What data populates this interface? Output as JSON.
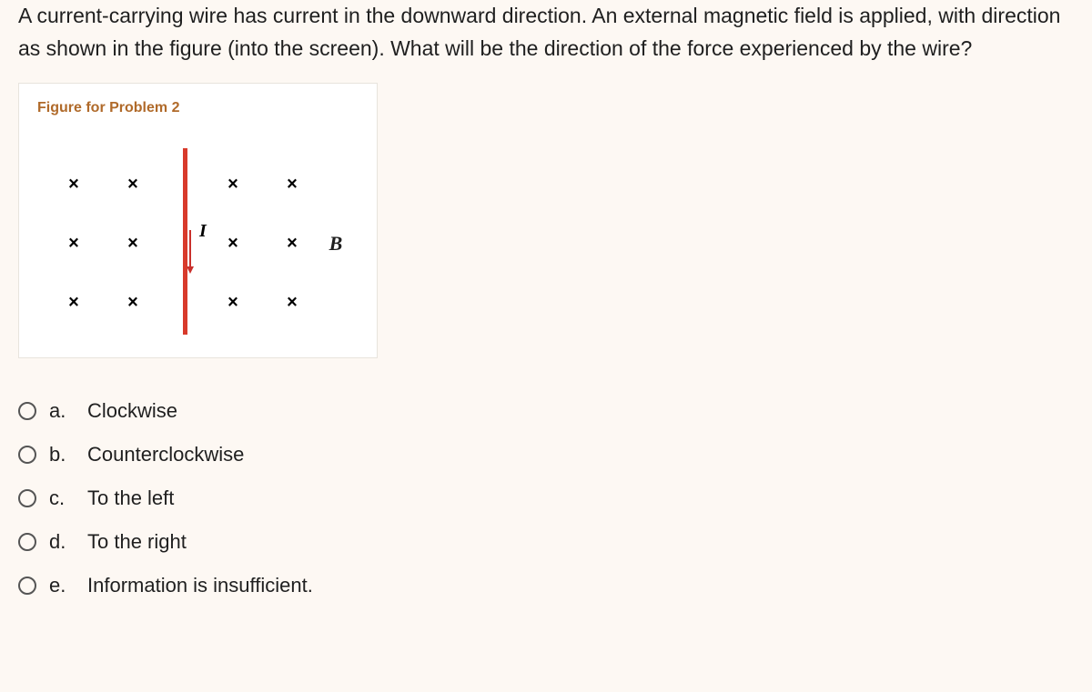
{
  "question": "A current-carrying wire has current in the downward direction. An external magnetic field is applied, with direction as shown in the figure (into the screen). What will be the direction of the force experienced by the wire?",
  "figure": {
    "caption": "Figure for Problem 2",
    "field_symbol": "×",
    "field_label": "B",
    "current_label": "I"
  },
  "options": [
    {
      "letter": "a.",
      "text": "Clockwise"
    },
    {
      "letter": "b.",
      "text": "Counterclockwise"
    },
    {
      "letter": "c.",
      "text": "To the left"
    },
    {
      "letter": "d.",
      "text": "To the right"
    },
    {
      "letter": "e.",
      "text": "Information is insufficient."
    }
  ]
}
